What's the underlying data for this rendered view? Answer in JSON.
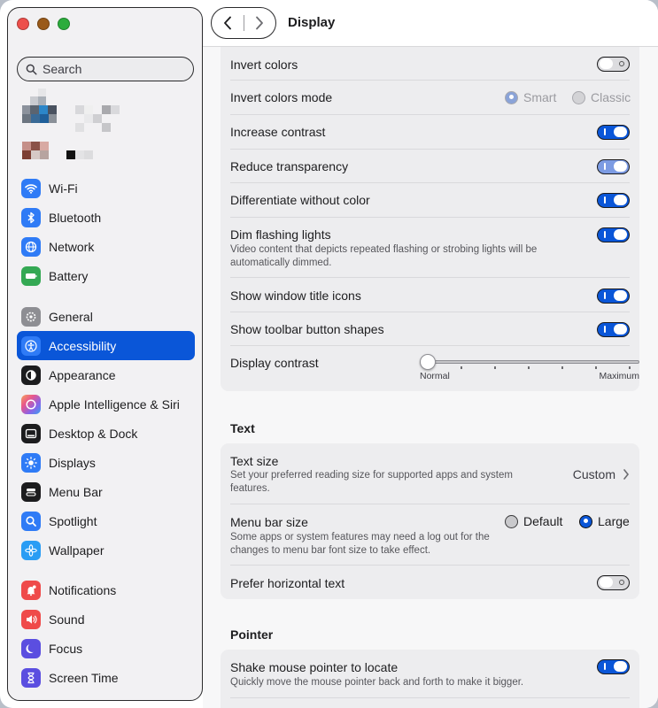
{
  "window": {
    "title": "Display"
  },
  "sidebar": {
    "search_placeholder": "Search",
    "groups": [
      [
        {
          "label": "Wi-Fi",
          "icon": "wifi-icon",
          "color": "#2f7bf6"
        },
        {
          "label": "Bluetooth",
          "icon": "bluetooth-icon",
          "color": "#2f7bf6"
        },
        {
          "label": "Network",
          "icon": "globe-icon",
          "color": "#2f7bf6"
        },
        {
          "label": "Battery",
          "icon": "battery-icon",
          "color": "#34a853"
        }
      ],
      [
        {
          "label": "General",
          "icon": "gear-icon",
          "color": "#8e8e93"
        },
        {
          "label": "Accessibility",
          "icon": "accessibility-icon",
          "color": "#2f7bf6",
          "active": true
        },
        {
          "label": "Appearance",
          "icon": "appearance-icon",
          "color": "#1c1c1e"
        },
        {
          "label": "Apple Intelligence & Siri",
          "icon": "siri-icon",
          "color": "#e8568c"
        },
        {
          "label": "Desktop & Dock",
          "icon": "dock-icon",
          "color": "#1c1c1e"
        },
        {
          "label": "Displays",
          "icon": "sun-icon",
          "color": "#2f7bf6"
        },
        {
          "label": "Menu Bar",
          "icon": "menubar-icon",
          "color": "#1c1c1e"
        },
        {
          "label": "Spotlight",
          "icon": "magnifier-icon",
          "color": "#2f7bf6"
        },
        {
          "label": "Wallpaper",
          "icon": "flower-icon",
          "color": "#2a9df4"
        }
      ],
      [
        {
          "label": "Notifications",
          "icon": "bell-icon",
          "color": "#ef4a4a"
        },
        {
          "label": "Sound",
          "icon": "speaker-icon",
          "color": "#ef4a4a"
        },
        {
          "label": "Focus",
          "icon": "moon-icon",
          "color": "#5b4ee0"
        },
        {
          "label": "Screen Time",
          "icon": "hourglass-icon",
          "color": "#5b4ee0"
        }
      ]
    ]
  },
  "display_group": {
    "invert_colors": {
      "label": "Invert colors",
      "on": false
    },
    "invert_mode": {
      "label": "Invert colors mode",
      "option1": "Smart",
      "option2": "Classic",
      "selected": "Smart",
      "disabled": true
    },
    "increase_contrast": {
      "label": "Increase contrast",
      "on": true
    },
    "reduce_transparency": {
      "label": "Reduce transparency",
      "on": true,
      "dimmed": true
    },
    "differentiate": {
      "label": "Differentiate without color",
      "on": true
    },
    "dim_flashing": {
      "label": "Dim flashing lights",
      "desc": "Video content that depicts repeated flashing or strobing lights will be automatically dimmed.",
      "on": true
    },
    "title_icons": {
      "label": "Show window title icons",
      "on": true
    },
    "toolbar_shapes": {
      "label": "Show toolbar button shapes",
      "on": true
    },
    "display_contrast": {
      "label": "Display contrast",
      "min_label": "Normal",
      "max_label": "Maximum",
      "value": 0
    }
  },
  "text_section": {
    "heading": "Text",
    "text_size": {
      "label": "Text size",
      "desc": "Set your preferred reading size for supported apps and system features.",
      "value": "Custom"
    },
    "menu_bar_size": {
      "label": "Menu bar size",
      "desc": "Some apps or system features may need a log out for the changes to menu bar font size to take effect.",
      "option1": "Default",
      "option2": "Large",
      "selected": "Large"
    },
    "horizontal_text": {
      "label": "Prefer horizontal text",
      "on": false
    }
  },
  "pointer_section": {
    "heading": "Pointer",
    "shake": {
      "label": "Shake mouse pointer to locate",
      "desc": "Quickly move the mouse pointer back and forth to make it bigger.",
      "on": true
    }
  }
}
